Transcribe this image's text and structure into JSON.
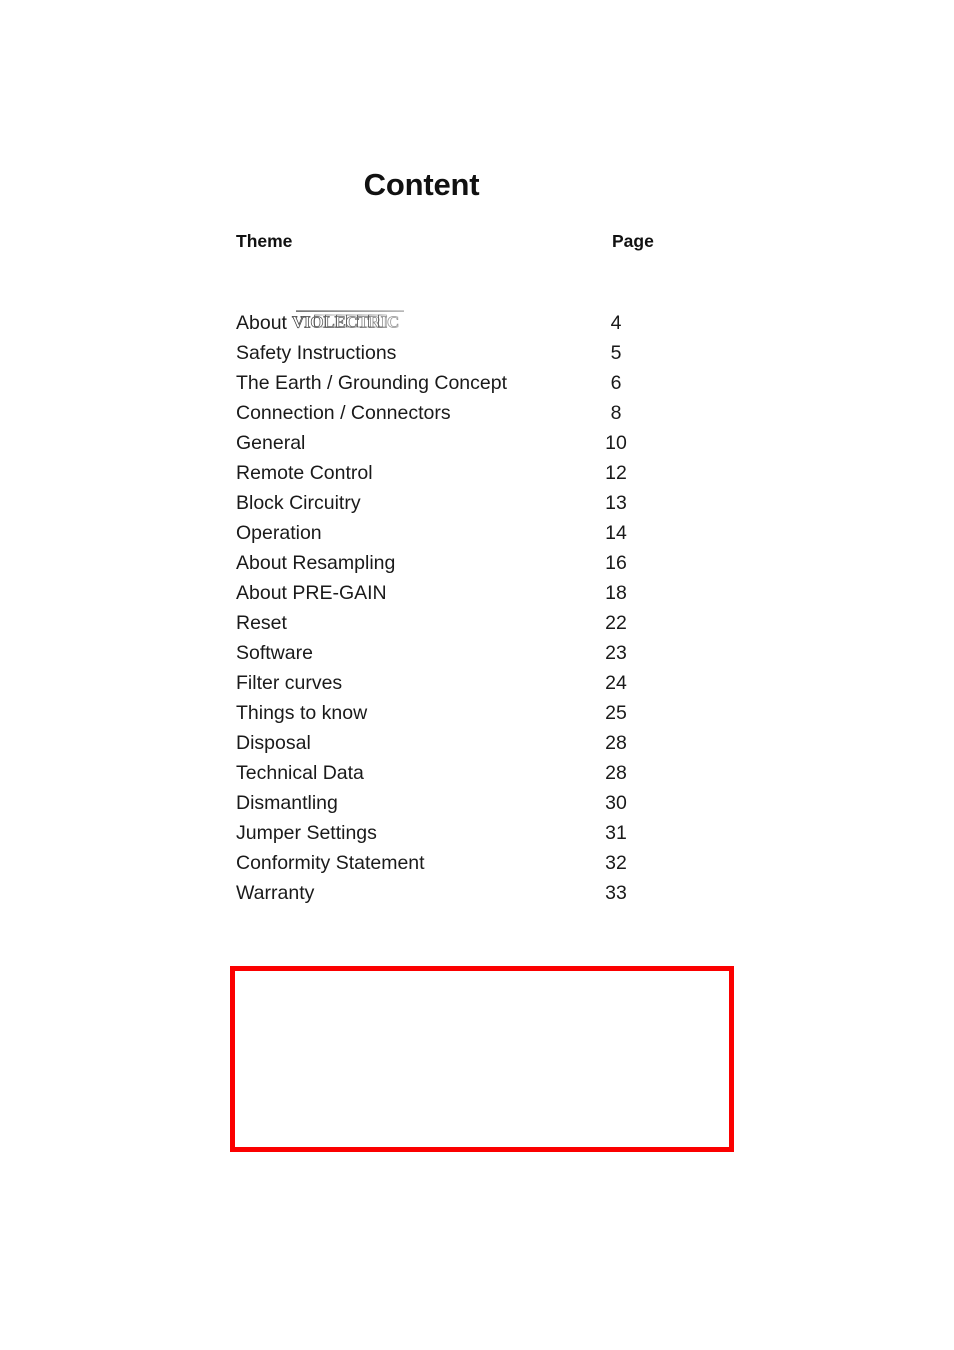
{
  "document": {
    "title": "Content",
    "background_color": "#ffffff",
    "text_color": "#1a1a1a"
  },
  "toc": {
    "header": {
      "theme_label": "Theme",
      "page_label": "Page"
    },
    "entries": [
      {
        "theme": "About",
        "brand": "VIOLECTRIC",
        "has_brandmark": true,
        "page": "4"
      },
      {
        "theme": "Safety Instructions",
        "has_brandmark": false,
        "page": "5"
      },
      {
        "theme": "The Earth / Grounding Concept",
        "has_brandmark": false,
        "page": "6"
      },
      {
        "theme": "Connection / Connectors",
        "has_brandmark": false,
        "page": "8"
      },
      {
        "theme": "General",
        "has_brandmark": false,
        "page": "10"
      },
      {
        "theme": "Remote Control",
        "has_brandmark": false,
        "page": "12"
      },
      {
        "theme": "Block Circuitry",
        "has_brandmark": false,
        "page": "13"
      },
      {
        "theme": "Operation",
        "has_brandmark": false,
        "page": "14"
      },
      {
        "theme": "About Resampling",
        "has_brandmark": false,
        "page": "16"
      },
      {
        "theme": "About PRE-GAIN",
        "has_brandmark": false,
        "page": "18"
      },
      {
        "theme": "Reset",
        "has_brandmark": false,
        "page": "22"
      },
      {
        "theme": "Software",
        "has_brandmark": false,
        "page": "23"
      },
      {
        "theme": "Filter curves",
        "has_brandmark": false,
        "page": "24"
      },
      {
        "theme": "Things to know",
        "has_brandmark": false,
        "page": "25"
      },
      {
        "theme": "Disposal",
        "has_brandmark": false,
        "page": "28"
      },
      {
        "theme": "Technical Data",
        "has_brandmark": false,
        "page": "28"
      },
      {
        "theme": "Dismantling",
        "has_brandmark": false,
        "page": "30"
      },
      {
        "theme": "Jumper Settings",
        "has_brandmark": false,
        "page": "31"
      },
      {
        "theme": "Conformity Statement",
        "has_brandmark": false,
        "page": "32"
      },
      {
        "theme": "Warranty",
        "has_brandmark": false,
        "page": "33"
      }
    ]
  },
  "annotation": {
    "type": "empty-rectangle",
    "border_color": "#fb0000",
    "border_width_px": 5,
    "content": ""
  }
}
